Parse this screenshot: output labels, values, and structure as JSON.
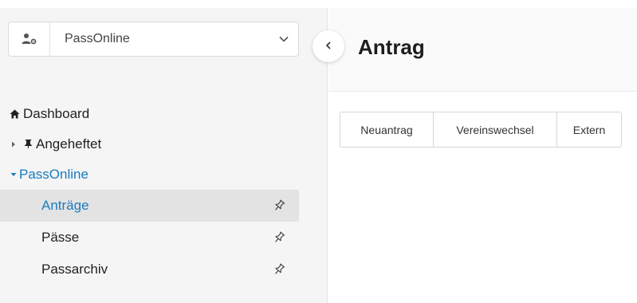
{
  "app_selector": {
    "selected": "PassOnline",
    "icon": "user-gear-icon"
  },
  "page": {
    "title": "Antrag"
  },
  "nav": {
    "dashboard": {
      "label": "Dashboard",
      "icon": "home-icon"
    },
    "pinned": {
      "label": "Angeheftet",
      "icon": "pin-icon"
    },
    "group": {
      "label": "PassOnline"
    },
    "items": [
      {
        "label": "Anträge",
        "active": true
      },
      {
        "label": "Pässe",
        "active": false
      },
      {
        "label": "Passarchiv",
        "active": false
      }
    ]
  },
  "buttons": [
    {
      "label": "Neuantrag"
    },
    {
      "label": "Vereinswechsel"
    },
    {
      "label": "Extern"
    }
  ],
  "colors": {
    "accent": "#1a7bbf",
    "active_bg": "#e3e3e3",
    "sidebar_bg": "#f5f5f5"
  }
}
